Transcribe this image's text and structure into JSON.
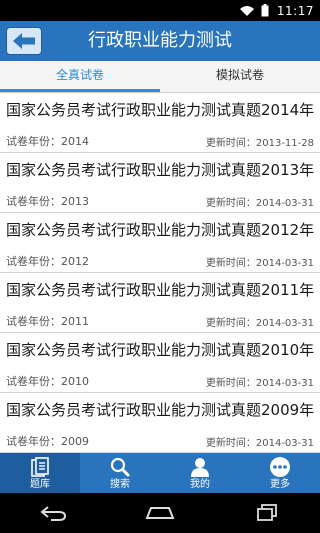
{
  "status": {
    "time": "11:17"
  },
  "header": {
    "title": "行政职业能力测试",
    "back_icon": "arrow-left-icon"
  },
  "tabs": [
    {
      "label": "全真试卷",
      "active": true
    },
    {
      "label": "模拟试卷",
      "active": false
    }
  ],
  "list": {
    "items": [
      {
        "title": "国家公务员考试行政职业能力测试真题2014年",
        "year": "试卷年份：2014",
        "updated": "更新时间：2013-11-28"
      },
      {
        "title": "国家公务员考试行政职业能力测试真题2013年",
        "year": "试卷年份：2013",
        "updated": "更新时间：2014-03-31"
      },
      {
        "title": "国家公务员考试行政职业能力测试真题2012年",
        "year": "试卷年份：2012",
        "updated": "更新时间：2014-03-31"
      },
      {
        "title": "国家公务员考试行政职业能力测试真题2011年",
        "year": "试卷年份：2011",
        "updated": "更新时间：2014-03-31"
      },
      {
        "title": "国家公务员考试行政职业能力测试真题2010年",
        "year": "试卷年份：2010",
        "updated": "更新时间：2014-03-31"
      },
      {
        "title": "国家公务员考试行政职业能力测试真题2009年",
        "year": "试卷年份：2009",
        "updated": "更新时间：2014-03-31"
      }
    ]
  },
  "bottom_nav": {
    "items": [
      {
        "label": "题库",
        "icon": "document-icon",
        "active": true
      },
      {
        "label": "搜索",
        "icon": "search-icon",
        "active": false
      },
      {
        "label": "我的",
        "icon": "user-icon",
        "active": false
      },
      {
        "label": "更多",
        "icon": "more-icon",
        "active": false
      }
    ]
  },
  "colors": {
    "primary": "#2a73bd",
    "tab_active": "#2a8be0"
  }
}
